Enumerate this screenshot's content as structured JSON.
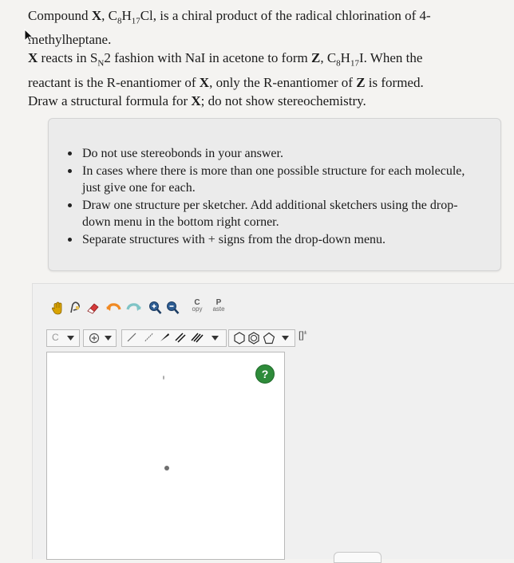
{
  "question": {
    "line1_a": "Compound ",
    "x": "X",
    "line1_b": ", C",
    "sub8": "8",
    "h": "H",
    "sub17": "17",
    "line1_c": "Cl, is a chiral product of the radical chlorination of 4-",
    "line2": "methylheptane.",
    "p2_x": "X",
    "p2_a": " reacts in S",
    "p2_subN": "N",
    "p2_b": "2 fashion with NaI in acetone to form ",
    "p2_z": "Z",
    "p2_c": ", C",
    "p2_sub8": "8",
    "p2_h": "H",
    "p2_sub17": "17",
    "p2_d": "I. When the",
    "p2_line2_a": "reactant is the R-enantiomer of ",
    "p2_line2_x": "X",
    "p2_line2_b": ", only the R-enantiomer of ",
    "p2_line2_z": "Z",
    "p2_line2_c": " is formed.",
    "p2_line3_a": "Draw a structural formula for ",
    "p2_line3_x": "X",
    "p2_line3_b": "; do not show stereochemistry."
  },
  "instructions": [
    "Do not use stereobonds in your answer.",
    "In cases where there is more than one possible structure for each molecule, just give one for each.",
    "Draw one structure per sketcher. Add additional sketchers using the drop-down menu in the bottom right corner.",
    "Separate structures with + signs from the drop-down menu."
  ],
  "toolbar": {
    "copy_label_top": "C",
    "copy_label_bottom": "opy",
    "paste_label_top": "P",
    "paste_label_bottom": "aste",
    "element_label": "C",
    "bracket_label": "[]",
    "bracket_sup": "±"
  },
  "help": {
    "label": "?"
  },
  "colors": {
    "help_green": "#2e8b3a",
    "hand_yellow": "#d9a300",
    "eraser_red": "#d43a3a",
    "lasso_orange": "#f08a24",
    "zoom_blue": "#2e5d93"
  }
}
